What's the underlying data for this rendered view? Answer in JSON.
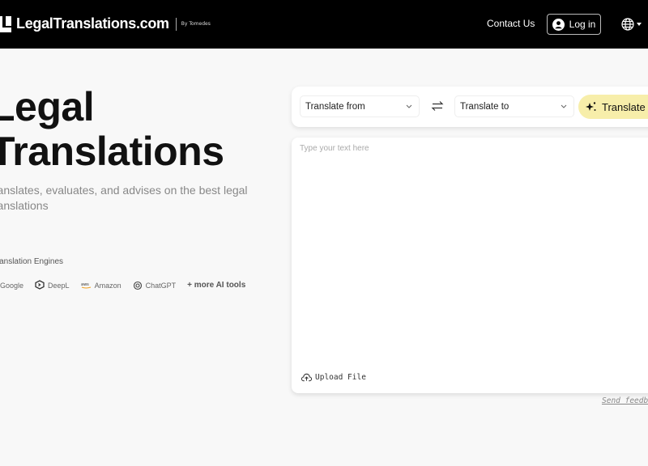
{
  "nav": {
    "logo": "LegalTranslations.com",
    "by": "By Tomedes",
    "contact": "Contact Us",
    "login": "Log in",
    "language_icon": "globe-icon"
  },
  "hero": {
    "title_line1": "Legal",
    "title_line2": "Translations",
    "subtitle": "translates, evaluates, and advises on the best legal translations",
    "engines_label": "Translation Engines",
    "engines": [
      "Google",
      "DeepL",
      "Amazon",
      "ChatGPT"
    ],
    "more": "+ more AI tools"
  },
  "translator": {
    "from": "Translate from",
    "to": "Translate to",
    "translate": "Translate",
    "placeholder": "Type your text here",
    "upload": "Upload File",
    "feedback": "Send feedback"
  },
  "colors": {
    "nav_bg": "#000000",
    "translate_btn": "#f7eeaa"
  }
}
